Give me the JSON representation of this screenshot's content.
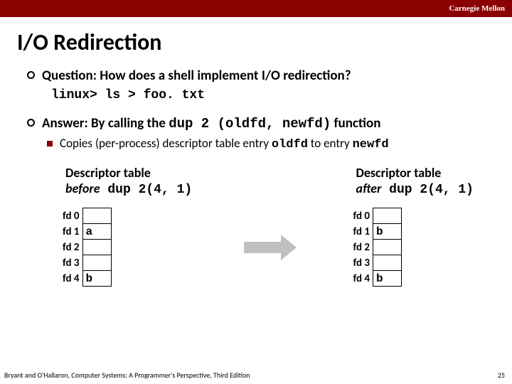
{
  "brand": "Carnegie Mellon",
  "title": "I/O Redirection",
  "q_prefix": "Question: How does a shell implement I/O redirection?",
  "cmd": "linux> ls > foo. txt",
  "a_prefix": "Answer: By calling the ",
  "a_code": "dup 2 (oldfd, newfd)",
  "a_suffix": "  function",
  "sub_prefix": "Copies (per-process) descriptor table entry ",
  "sub_code1": "oldfd",
  "sub_mid": " to entry ",
  "sub_code2": "newfd",
  "before": {
    "cap_line1": "Descriptor table",
    "cap_em": "before",
    "cap_code": " dup 2(4, 1)",
    "rows": [
      {
        "label": "fd 0",
        "val": ""
      },
      {
        "label": "fd 1",
        "val": "a"
      },
      {
        "label": "fd 2",
        "val": ""
      },
      {
        "label": "fd 3",
        "val": ""
      },
      {
        "label": "fd 4",
        "val": "b"
      }
    ]
  },
  "after": {
    "cap_line1": "Descriptor table",
    "cap_em": "after",
    "cap_code": " dup 2(4, 1)",
    "rows": [
      {
        "label": "fd 0",
        "val": ""
      },
      {
        "label": "fd 1",
        "val": "b"
      },
      {
        "label": "fd 2",
        "val": ""
      },
      {
        "label": "fd 3",
        "val": ""
      },
      {
        "label": "fd 4",
        "val": "b"
      }
    ]
  },
  "footer_left": "Bryant and O'Hallaron, Computer Systems: A Programmer's Perspective, Third Edition",
  "footer_right": "25"
}
